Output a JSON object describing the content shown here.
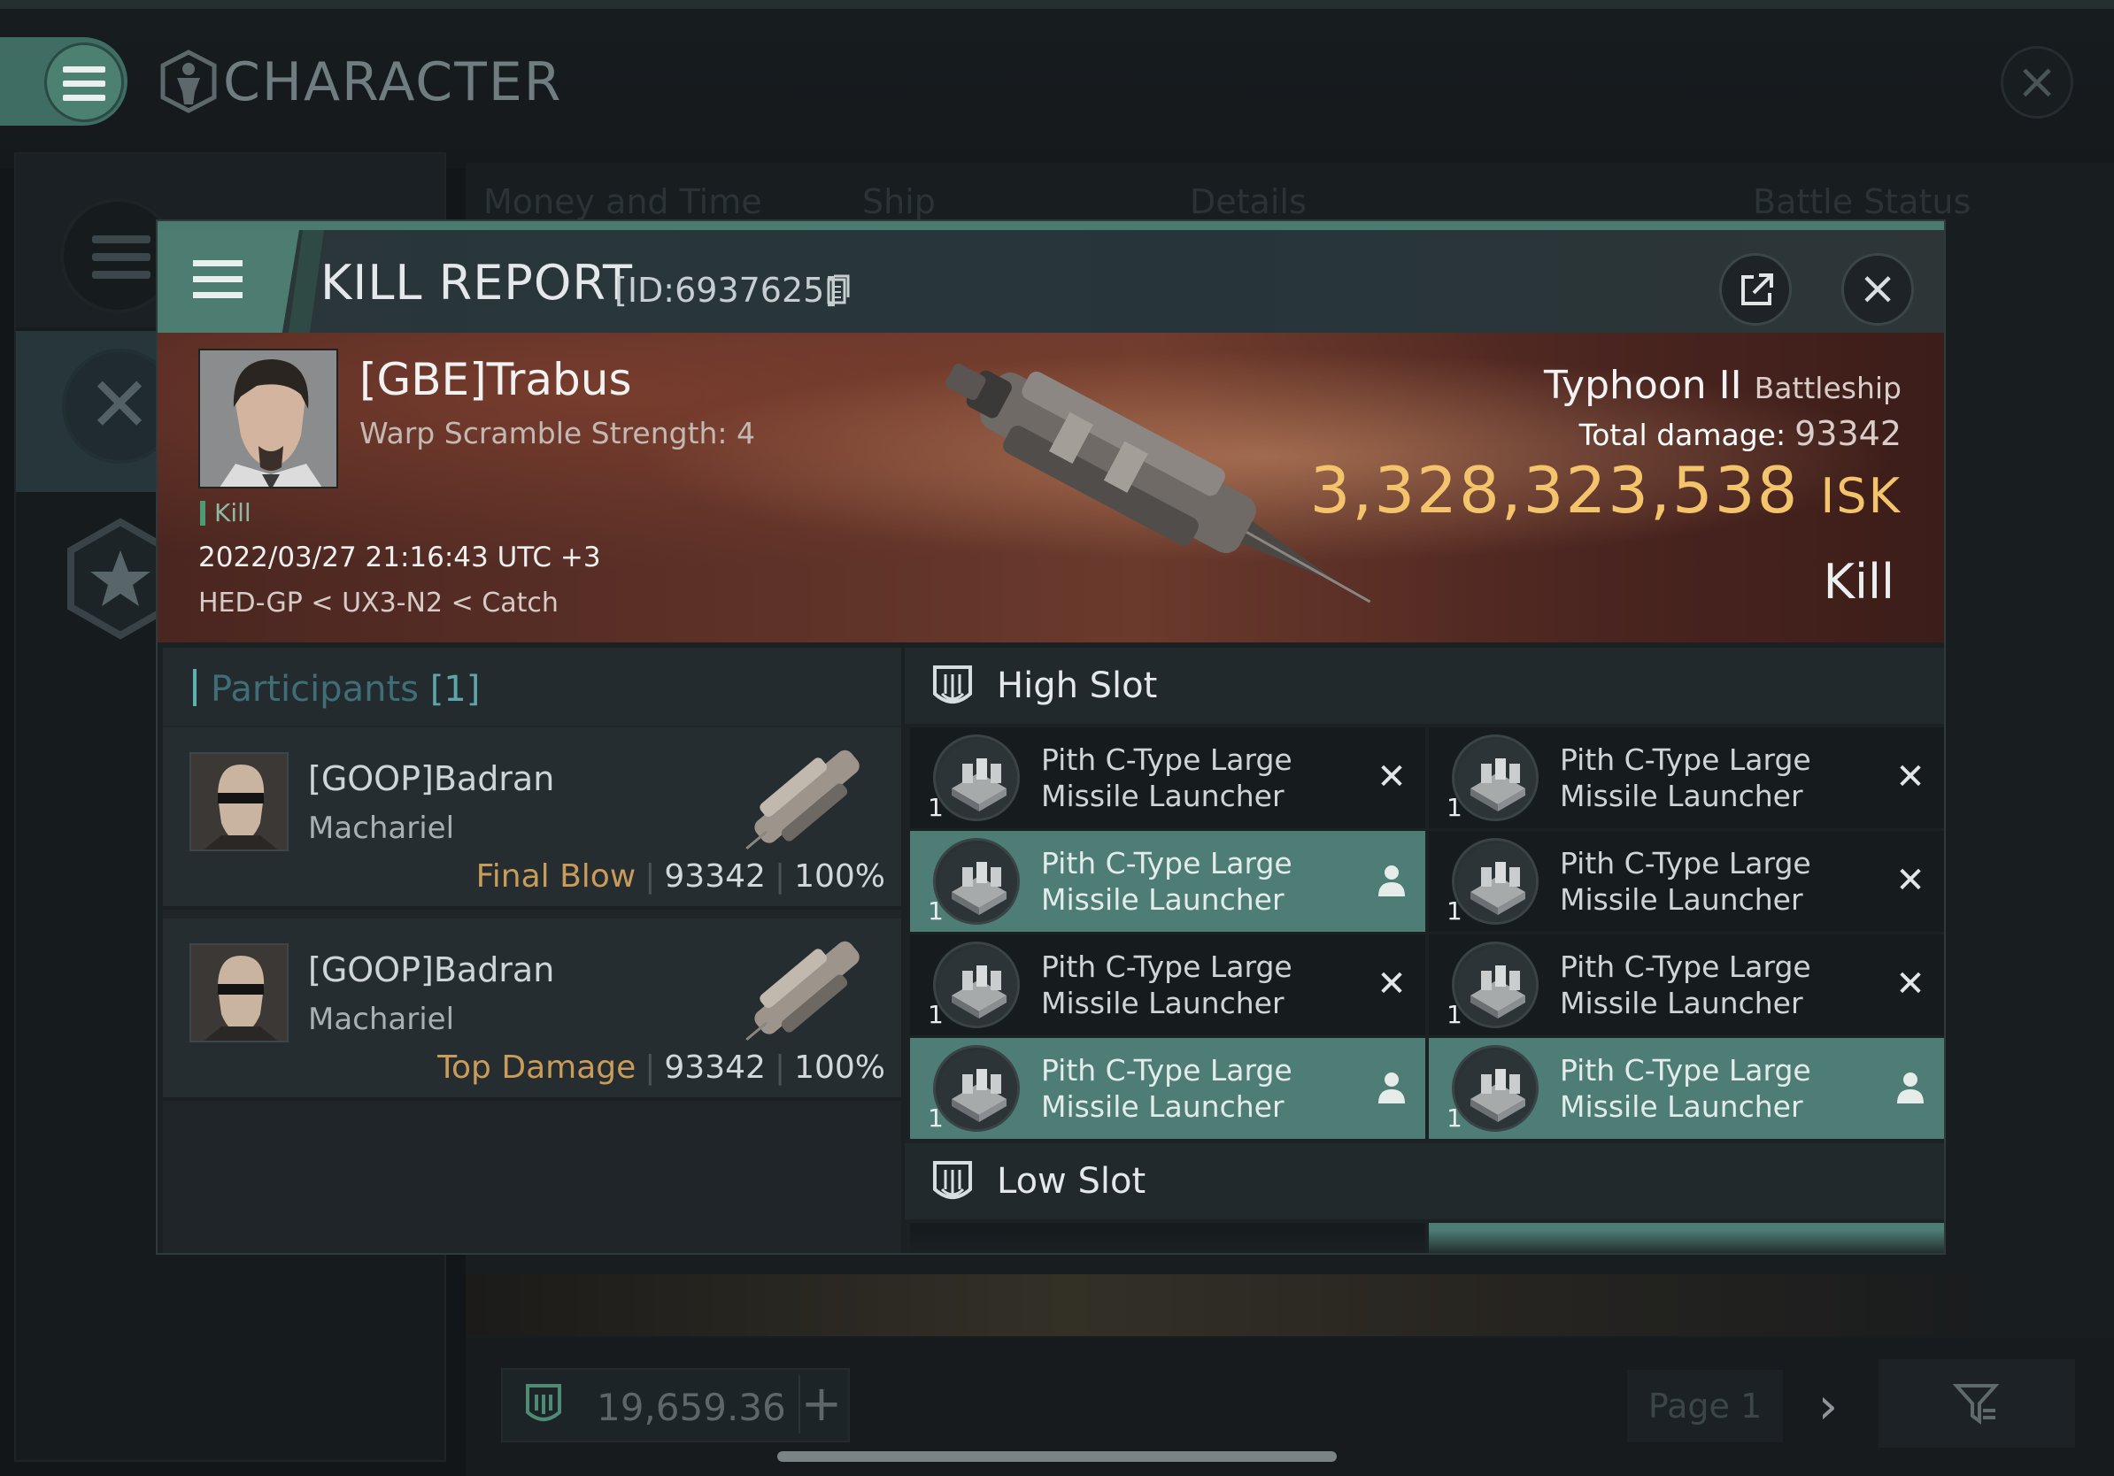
{
  "app": {
    "title": "CHARACTER",
    "bg_tabs": [
      "Money and Time",
      "Ship",
      "Details",
      "Battle Status"
    ],
    "wallet": "19,659.36",
    "page_label": "Page 1"
  },
  "modal": {
    "title": "KILL REPORT",
    "id": "[ID:6937625]",
    "victim": {
      "name": "[GBE]Trabus",
      "subtitle": "Warp Scramble Strength: 4",
      "tag": "Kill",
      "datetime": "2022/03/27 21:16:43 UTC +3",
      "location": "HED-GP < UX3-N2 < Catch",
      "ship": "Typhoon II",
      "ship_class": "Battleship",
      "total_damage_label": "Total damage:",
      "total_damage": "93342",
      "isk_value": "3,328,323,538",
      "isk_unit": "ISK",
      "result": "Kill"
    },
    "participants": {
      "label": "Participants",
      "count": "[1]",
      "rows": [
        {
          "name": "[GOOP]Badran",
          "ship": "Machariel",
          "role": "Final Blow",
          "damage": "93342",
          "percent": "100%"
        },
        {
          "name": "[GOOP]Badran",
          "ship": "Machariel",
          "role": "Top Damage",
          "damage": "93342",
          "percent": "100%"
        }
      ]
    },
    "fitting": {
      "high_slot_label": "High Slot",
      "low_slot_label": "Low Slot",
      "high_modules": [
        {
          "name": "Pith C-Type Large Missile Launcher",
          "qty": "1",
          "status": "destroyed"
        },
        {
          "name": "Pith C-Type Large Missile Launcher",
          "qty": "1",
          "status": "destroyed"
        },
        {
          "name": "Pith C-Type Large Missile Launcher",
          "qty": "1",
          "status": "dropped"
        },
        {
          "name": "Pith C-Type Large Missile Launcher",
          "qty": "1",
          "status": "destroyed"
        },
        {
          "name": "Pith C-Type Large Missile Launcher",
          "qty": "1",
          "status": "destroyed"
        },
        {
          "name": "Pith C-Type Large Missile Launcher",
          "qty": "1",
          "status": "destroyed"
        },
        {
          "name": "Pith C-Type Large Missile Launcher",
          "qty": "1",
          "status": "dropped"
        },
        {
          "name": "Pith C-Type Large Missile Launcher",
          "qty": "1",
          "status": "dropped"
        }
      ]
    }
  },
  "colors": {
    "accent": "#4c7d70",
    "isk": "#f3c46b",
    "role": "#c99c59",
    "participants": "#5ca5a9"
  },
  "icons": [
    "menu-icon",
    "character-icon",
    "close-icon",
    "copy-icon",
    "share-icon",
    "slot-icon",
    "destroyed-icon",
    "dropped-icon"
  ]
}
